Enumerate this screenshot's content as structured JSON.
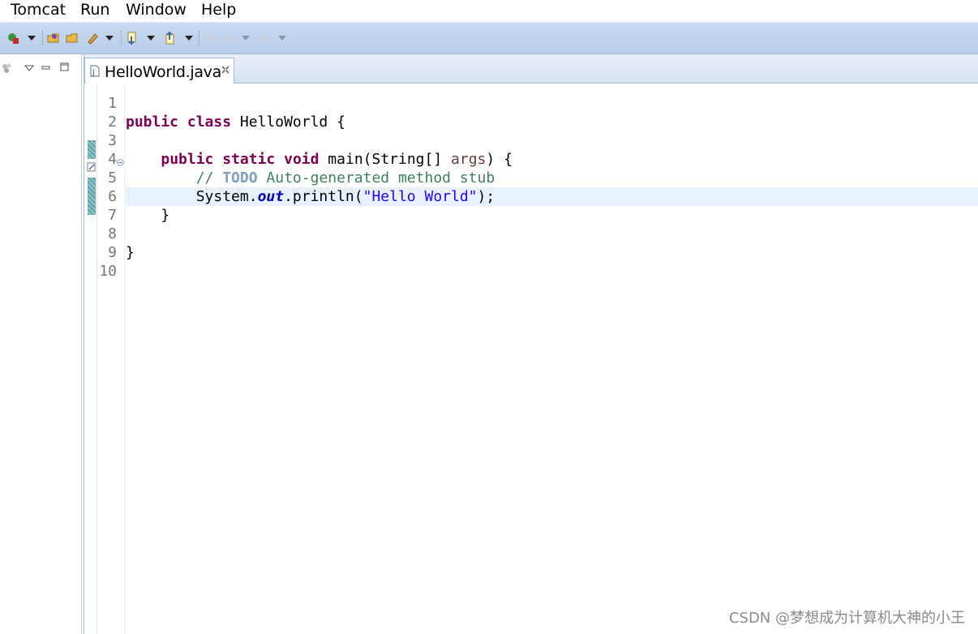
{
  "menu": {
    "items": [
      "Tomcat",
      "Run",
      "Window",
      "Help"
    ]
  },
  "toolbar": {
    "icons": [
      "new-server-icon",
      "dropdown-arrow-icon",
      "open-type-icon",
      "open-resource-icon",
      "edit-pen-icon",
      "dropdown-arrow-icon",
      "next-annotation-icon",
      "dropdown-arrow-icon",
      "previous-annotation-icon",
      "dropdown-arrow-icon",
      "back-icon",
      "back-icon",
      "dropdown-arrow-icon",
      "forward-icon",
      "dropdown-arrow-icon"
    ]
  },
  "editor": {
    "tab": {
      "label": "HelloWorld.java"
    },
    "line_numbers": [
      "1",
      "2",
      "3",
      "4",
      "5",
      "6",
      "7",
      "8",
      "9",
      "10"
    ],
    "lines": [
      {
        "segments": []
      },
      {
        "segments": [
          {
            "t": "public",
            "c": "kw"
          },
          {
            "t": " "
          },
          {
            "t": "class",
            "c": "kw"
          },
          {
            "t": " HelloWorld {"
          }
        ]
      },
      {
        "segments": []
      },
      {
        "segments": [
          {
            "t": "    "
          },
          {
            "t": "public",
            "c": "kw"
          },
          {
            "t": " "
          },
          {
            "t": "static",
            "c": "kw"
          },
          {
            "t": " "
          },
          {
            "t": "void",
            "c": "kw"
          },
          {
            "t": " main(String[] "
          },
          {
            "t": "args",
            "c": "param"
          },
          {
            "t": ") {"
          }
        ]
      },
      {
        "segments": [
          {
            "t": "        "
          },
          {
            "t": "// ",
            "c": "cm"
          },
          {
            "t": "TODO",
            "c": "todo"
          },
          {
            "t": " Auto-generated method stub",
            "c": "cm"
          }
        ]
      },
      {
        "segments": [
          {
            "t": "        System."
          },
          {
            "t": "out",
            "c": "field"
          },
          {
            "t": ".println("
          },
          {
            "t": "\"Hello World\"",
            "c": "str"
          },
          {
            "t": ");"
          }
        ],
        "current": true
      },
      {
        "segments": [
          {
            "t": "    }"
          }
        ]
      },
      {
        "segments": []
      },
      {
        "segments": [
          {
            "t": "}"
          }
        ]
      },
      {
        "segments": []
      }
    ]
  },
  "colors": {
    "keyword": "#7f0055",
    "comment": "#3f7f5f",
    "todo": "#7f9fbf",
    "string": "#2a00ff",
    "field": "#0000c0",
    "current_line": "#e8f2fe",
    "toolbar": "#b7cde9"
  },
  "watermark": "CSDN @梦想成为计算机大神的小王"
}
